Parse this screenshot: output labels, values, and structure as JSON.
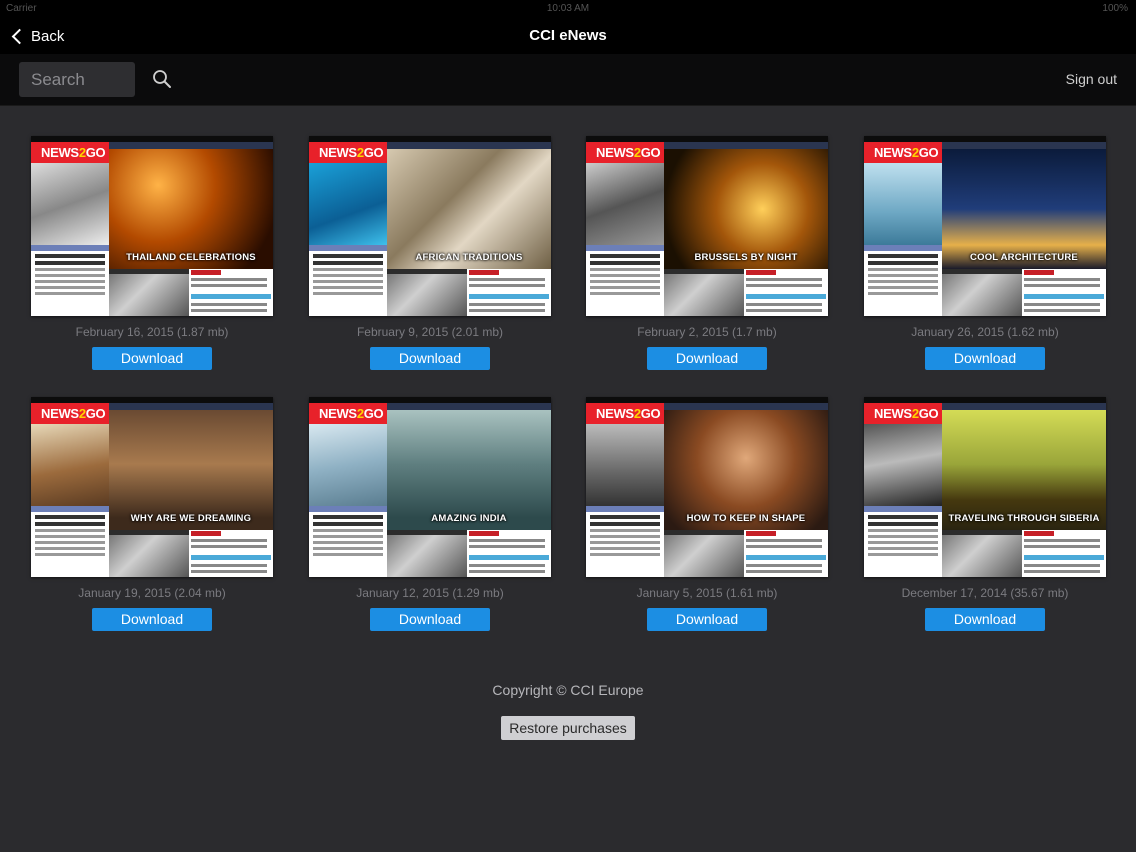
{
  "status_bar": {
    "carrier": "Carrier",
    "time": "10:03 AM",
    "battery": "100%"
  },
  "nav": {
    "back_label": "Back",
    "title": "CCI eNews"
  },
  "toolbar": {
    "search_placeholder": "Search",
    "search_value": "",
    "sign_out_label": "Sign out"
  },
  "colors": {
    "accent": "#1c8ee3",
    "logo_red": "#e8212a",
    "background": "#2b2b2e"
  },
  "issues": [
    {
      "headline": "THAILAND CELEBRATIONS",
      "date": "February 16, 2015 (1.87 mb)",
      "download_label": "Download"
    },
    {
      "headline": "AFRICAN TRADITIONS",
      "date": "February 9, 2015 (2.01 mb)",
      "download_label": "Download"
    },
    {
      "headline": "BRUSSELS BY NIGHT",
      "date": "February 2, 2015 (1.7 mb)",
      "download_label": "Download"
    },
    {
      "headline": "COOL ARCHITECTURE",
      "date": "January 26, 2015 (1.62 mb)",
      "download_label": "Download"
    },
    {
      "headline": "WHY ARE WE DREAMING",
      "date": "January 19, 2015 (2.04 mb)",
      "download_label": "Download"
    },
    {
      "headline": "AMAZING INDIA",
      "date": "January 12, 2015 (1.29 mb)",
      "download_label": "Download"
    },
    {
      "headline": "HOW TO KEEP IN SHAPE",
      "date": "January 5, 2015 (1.61 mb)",
      "download_label": "Download"
    },
    {
      "headline": "TRAVELING THROUGH SIBERIA",
      "date": "December 17, 2014 (35.67 mb)",
      "download_label": "Download"
    }
  ],
  "logo": {
    "part1": "NEWS",
    "part2": "2",
    "part3": "GO"
  },
  "footer": {
    "copyright": "Copyright © CCI Europe",
    "restore_label": "Restore purchases"
  }
}
